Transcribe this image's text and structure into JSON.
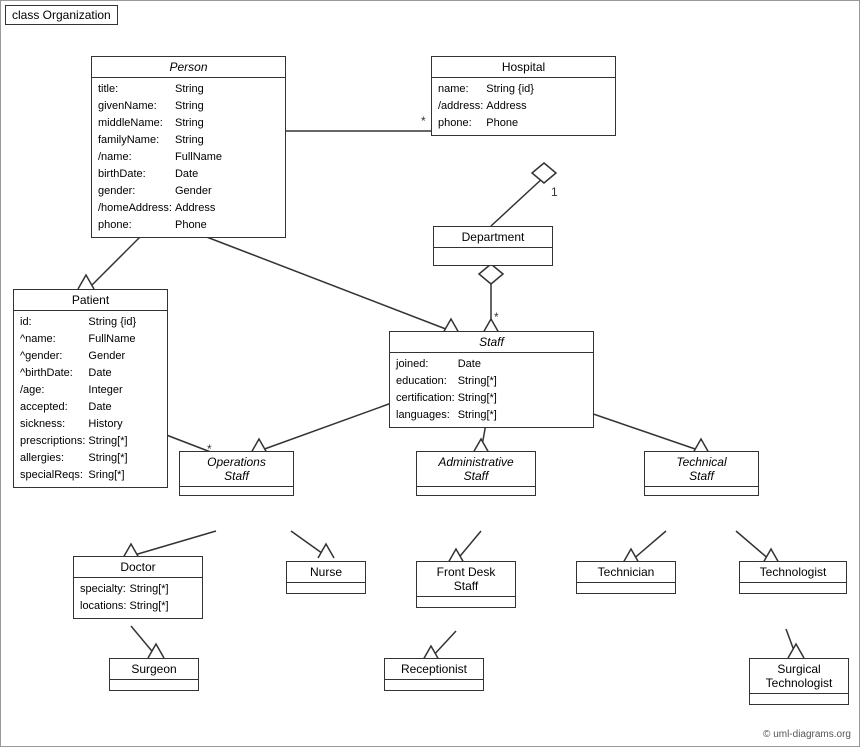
{
  "diagram_title": "class Organization",
  "copyright": "© uml-diagrams.org",
  "classes": {
    "person": {
      "title": "Person",
      "italic": true,
      "attrs": [
        [
          "title:",
          "String"
        ],
        [
          "givenName:",
          "String"
        ],
        [
          "middleName:",
          "String"
        ],
        [
          "familyName:",
          "String"
        ],
        [
          "/name:",
          "FullName"
        ],
        [
          "birthDate:",
          "Date"
        ],
        [
          "gender:",
          "Gender"
        ],
        [
          "/homeAddress:",
          "Address"
        ],
        [
          "phone:",
          "Phone"
        ]
      ]
    },
    "hospital": {
      "title": "Hospital",
      "attrs": [
        [
          "name:",
          "String {id}"
        ],
        [
          "/address:",
          "Address"
        ],
        [
          "phone:",
          "Phone"
        ]
      ]
    },
    "patient": {
      "title": "Patient",
      "attrs": [
        [
          "id:",
          "String {id}"
        ],
        [
          "^name:",
          "FullName"
        ],
        [
          "^gender:",
          "Gender"
        ],
        [
          "^birthDate:",
          "Date"
        ],
        [
          "/age:",
          "Integer"
        ],
        [
          "accepted:",
          "Date"
        ],
        [
          "sickness:",
          "History"
        ],
        [
          "prescriptions:",
          "String[*]"
        ],
        [
          "allergies:",
          "String[*]"
        ],
        [
          "specialReqs:",
          "Sring[*]"
        ]
      ]
    },
    "department": {
      "title": "Department",
      "attrs": []
    },
    "staff": {
      "title": "Staff",
      "italic": true,
      "attrs": [
        [
          "joined:",
          "Date"
        ],
        [
          "education:",
          "String[*]"
        ],
        [
          "certification:",
          "String[*]"
        ],
        [
          "languages:",
          "String[*]"
        ]
      ]
    },
    "operations_staff": {
      "title": "Operations Staff",
      "italic": true,
      "attrs": []
    },
    "administrative_staff": {
      "title": "Administrative Staff",
      "italic": true,
      "attrs": []
    },
    "technical_staff": {
      "title": "Technical Staff",
      "italic": true,
      "attrs": []
    },
    "doctor": {
      "title": "Doctor",
      "attrs": [
        [
          "specialty:",
          "String[*]"
        ],
        [
          "locations:",
          "String[*]"
        ]
      ]
    },
    "nurse": {
      "title": "Nurse",
      "attrs": []
    },
    "front_desk_staff": {
      "title": "Front Desk Staff",
      "attrs": []
    },
    "technician": {
      "title": "Technician",
      "attrs": []
    },
    "technologist": {
      "title": "Technologist",
      "attrs": []
    },
    "surgeon": {
      "title": "Surgeon",
      "attrs": []
    },
    "receptionist": {
      "title": "Receptionist",
      "attrs": []
    },
    "surgical_technologist": {
      "title": "Surgical Technologist",
      "attrs": []
    }
  }
}
